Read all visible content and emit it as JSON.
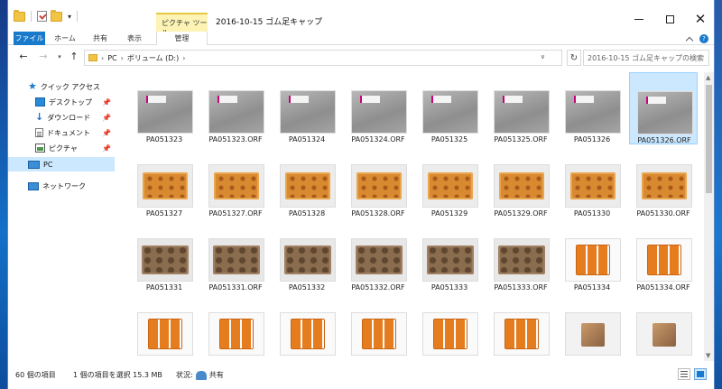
{
  "window": {
    "title": "2016-10-15 ゴム足キャップ",
    "contextual_tab": "ピクチャ ツール"
  },
  "ribbon": {
    "tabs": [
      "ファイル",
      "ホーム",
      "共有",
      "表示",
      "管理"
    ],
    "help": "?"
  },
  "nav": {
    "breadcrumb": [
      "PC",
      "ボリューム (D:)"
    ],
    "search_placeholder": "2016-10-15 ゴム足キャップの検索"
  },
  "sidebar": {
    "items": [
      {
        "label": "クイック アクセス",
        "icon": "star-icon",
        "pinned": false
      },
      {
        "label": "デスクトップ",
        "icon": "desktop-icon",
        "pinned": true
      },
      {
        "label": "ダウンロード",
        "icon": "download-icon",
        "pinned": true
      },
      {
        "label": "ドキュメント",
        "icon": "document-icon",
        "pinned": true
      },
      {
        "label": "ピクチャ",
        "icon": "pictures-icon",
        "pinned": true
      },
      {
        "label": "PC",
        "icon": "pc-icon",
        "pinned": false,
        "selected": true
      },
      {
        "label": "ネットワーク",
        "icon": "network-icon",
        "pinned": false
      }
    ]
  },
  "files": [
    {
      "name": "PA051323",
      "thumb": "gray"
    },
    {
      "name": "PA051323.ORF",
      "thumb": "gray"
    },
    {
      "name": "PA051324",
      "thumb": "gray"
    },
    {
      "name": "PA051324.ORF",
      "thumb": "gray"
    },
    {
      "name": "PA051325",
      "thumb": "gray"
    },
    {
      "name": "PA051325.ORF",
      "thumb": "gray"
    },
    {
      "name": "PA051326",
      "thumb": "gray"
    },
    {
      "name": "PA051326.ORF",
      "thumb": "gray",
      "selected": true
    },
    {
      "name": "PA051327",
      "thumb": "orange"
    },
    {
      "name": "PA051327.ORF",
      "thumb": "orange"
    },
    {
      "name": "PA051328",
      "thumb": "orange"
    },
    {
      "name": "PA051328.ORF",
      "thumb": "orange"
    },
    {
      "name": "PA051329",
      "thumb": "orange"
    },
    {
      "name": "PA051329.ORF",
      "thumb": "orange"
    },
    {
      "name": "PA051330",
      "thumb": "orange"
    },
    {
      "name": "PA051330.ORF",
      "thumb": "orange"
    },
    {
      "name": "PA051331",
      "thumb": "brown"
    },
    {
      "name": "PA051331.ORF",
      "thumb": "brown"
    },
    {
      "name": "PA051332",
      "thumb": "brown"
    },
    {
      "name": "PA051332.ORF",
      "thumb": "brown"
    },
    {
      "name": "PA051333",
      "thumb": "brown"
    },
    {
      "name": "PA051333.ORF",
      "thumb": "brown"
    },
    {
      "name": "PA051334",
      "thumb": "tray"
    },
    {
      "name": "PA051334.ORF",
      "thumb": "tray"
    },
    {
      "name": "",
      "thumb": "tray"
    },
    {
      "name": "",
      "thumb": "tray"
    },
    {
      "name": "",
      "thumb": "tray"
    },
    {
      "name": "",
      "thumb": "tray"
    },
    {
      "name": "",
      "thumb": "tray"
    },
    {
      "name": "",
      "thumb": "tray"
    },
    {
      "name": "",
      "thumb": "cube"
    },
    {
      "name": "",
      "thumb": "cube"
    }
  ],
  "status": {
    "item_count": "60 個の項目",
    "selection": "1 個の項目を選択  15.3 MB",
    "state_label": "状況:",
    "state_value": "共有"
  },
  "colors": {
    "accent": "#1979ca",
    "selection": "#cce8ff",
    "contextual": "#fdf3b4"
  }
}
